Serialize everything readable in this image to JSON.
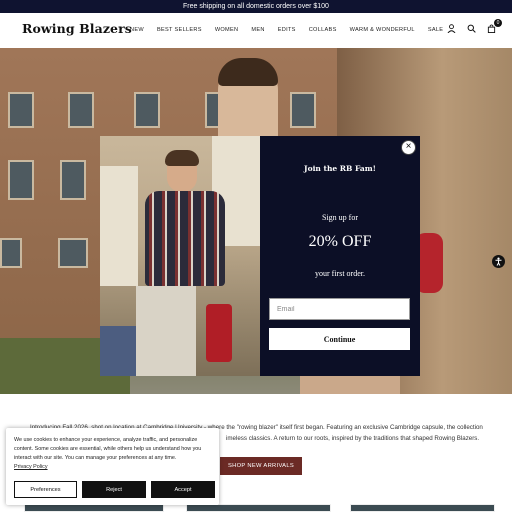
{
  "promo": {
    "text": "Free shipping on all domestic orders over $100"
  },
  "header": {
    "logo": "Rowing Blazers",
    "nav": [
      "NEW",
      "BEST SELLERS",
      "WOMEN",
      "MEN",
      "EDITS",
      "COLLABS",
      "WARM & WONDERFUL",
      "SALE"
    ],
    "icons": [
      "account-icon",
      "search-icon",
      "cart-icon"
    ],
    "cart_count": "0"
  },
  "modal": {
    "title": "Join the RB Fam!",
    "signup": "Sign up for",
    "offer": "20% OFF",
    "first_order": "your first order.",
    "email_placeholder": "Email",
    "continue_label": "Continue",
    "close_symbol": "×"
  },
  "main": {
    "intro": "Introducing Fall 2026, shot on location at Cambridge University - where the \"rowing blazer\" itself first began. Featuring an exclusive Cambridge capsule, the collection imbues timeless classics. A return to our roots, inspired by the traditions that shaped Rowing Blazers.",
    "intro_visible_line1": "Introducing Fall 2026, shot on location at Cambridge University - where the \"rowing blazer\" itself first began. Featuring an exclusive Cambridge capsule, the collection",
    "intro_visible_line2": "imeless classics. A return to our roots, inspired by the traditions that shaped Rowing Blazers.",
    "shop_button": "SHOP NEW ARRIVALS"
  },
  "cookie": {
    "text": "We use cookies to enhance your experience, analyze traffic, and personalize content. Some cookies are essential, while others help us understand how you interact with our site. You can manage your preferences at any time.",
    "link": "Privacy Policy",
    "preferences": "Preferences",
    "reject": "Reject",
    "accept": "Accept"
  },
  "colors": {
    "promo_bg": "#0f1330",
    "modal_bg": "#0c0f26",
    "shop_button_bg": "#6b2a25"
  }
}
